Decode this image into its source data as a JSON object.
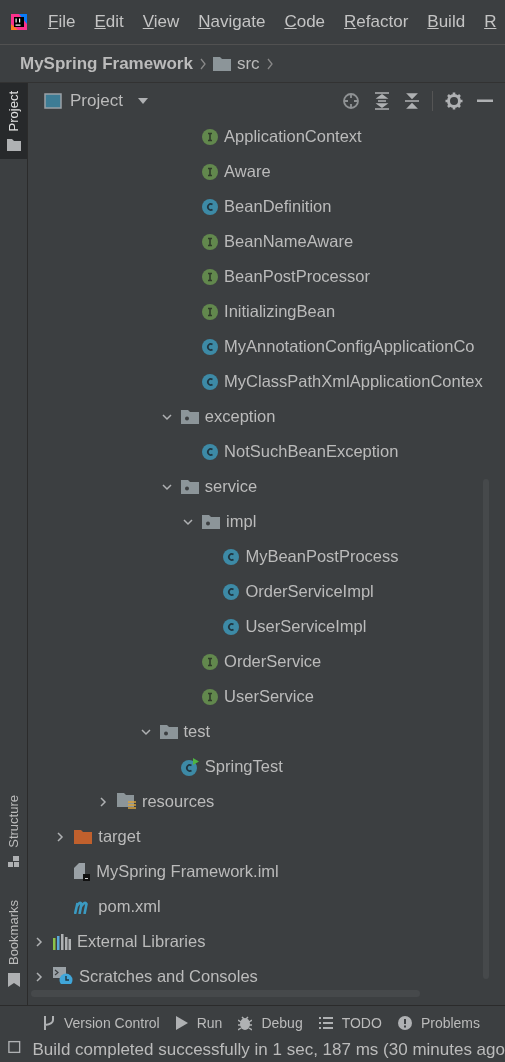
{
  "menu": [
    "File",
    "Edit",
    "View",
    "Navigate",
    "Code",
    "Refactor",
    "Build",
    "R"
  ],
  "breadcrumb": {
    "project": "MySpring Framework",
    "folder": "src"
  },
  "panel": {
    "title": "Project"
  },
  "side_tabs_top": [
    {
      "label": "Project",
      "kind": "project",
      "selected": true
    }
  ],
  "side_tabs_bottom": [
    {
      "label": "Structure",
      "kind": "structure",
      "selected": false
    },
    {
      "label": "Bookmarks",
      "kind": "bookmarks",
      "selected": false
    }
  ],
  "tree": [
    {
      "children": [
        {
          "children": [
            {
              "children": [
                {
                  "children": [
                    {
                      "children": [
                        {
                          "children": [
                            {
                              "children": [
                                {
                                  "label": "ApplicationContext",
                                  "kind": "interface"
                                },
                                {
                                  "label": "Aware",
                                  "kind": "interface"
                                },
                                {
                                  "label": "BeanDefinition",
                                  "kind": "class"
                                },
                                {
                                  "label": "BeanNameAware",
                                  "kind": "interface"
                                },
                                {
                                  "label": "BeanPostProcessor",
                                  "kind": "interface"
                                },
                                {
                                  "label": "InitializingBean",
                                  "kind": "interface"
                                },
                                {
                                  "label": "MyAnnotationConfigApplicationCo",
                                  "kind": "class"
                                },
                                {
                                  "label": "MyClassPathXmlApplicationContex",
                                  "kind": "class"
                                }
                              ]
                            },
                            {
                              "label": "exception",
                              "kind": "package",
                              "expanded": true,
                              "children": [
                                {
                                  "label": "NotSuchBeanException",
                                  "kind": "class"
                                }
                              ]
                            },
                            {
                              "label": "service",
                              "kind": "package",
                              "expanded": true,
                              "children": [
                                {
                                  "label": "impl",
                                  "kind": "package",
                                  "expanded": true,
                                  "children": [
                                    {
                                      "label": "MyBeanPostProcess",
                                      "kind": "class"
                                    },
                                    {
                                      "label": "OrderServiceImpl",
                                      "kind": "class"
                                    },
                                    {
                                      "label": "UserServiceImpl",
                                      "kind": "class"
                                    }
                                  ]
                                },
                                {
                                  "label": "OrderService",
                                  "kind": "interface"
                                },
                                {
                                  "label": "UserService",
                                  "kind": "interface"
                                }
                              ]
                            }
                          ]
                        },
                        {
                          "label": "test",
                          "kind": "package",
                          "expanded": true,
                          "children": [
                            {
                              "label": "SpringTest",
                              "kind": "test"
                            }
                          ]
                        }
                      ]
                    }
                  ]
                },
                {
                  "label": "resources",
                  "kind": "resources",
                  "expanded": false
                }
              ]
            }
          ]
        },
        {
          "label": "target",
          "kind": "target",
          "expanded": false
        },
        {
          "label": "MySpring Framework.iml",
          "kind": "iml"
        },
        {
          "label": "pom.xml",
          "kind": "maven"
        }
      ]
    },
    {
      "label": "External Libraries",
      "kind": "libraries",
      "expanded": false
    },
    {
      "label": "Scratches and Consoles",
      "kind": "scratches",
      "expanded": false
    }
  ],
  "tool_windows": [
    {
      "label": "Version Control",
      "kind": "vcs"
    },
    {
      "label": "Run",
      "kind": "run"
    },
    {
      "label": "Debug",
      "kind": "debug"
    },
    {
      "label": "TODO",
      "kind": "todo"
    },
    {
      "label": "Problems",
      "kind": "problems"
    }
  ],
  "status_bar": {
    "message": "Build completed successfully in 1 sec, 187 ms (30 minutes ago"
  }
}
